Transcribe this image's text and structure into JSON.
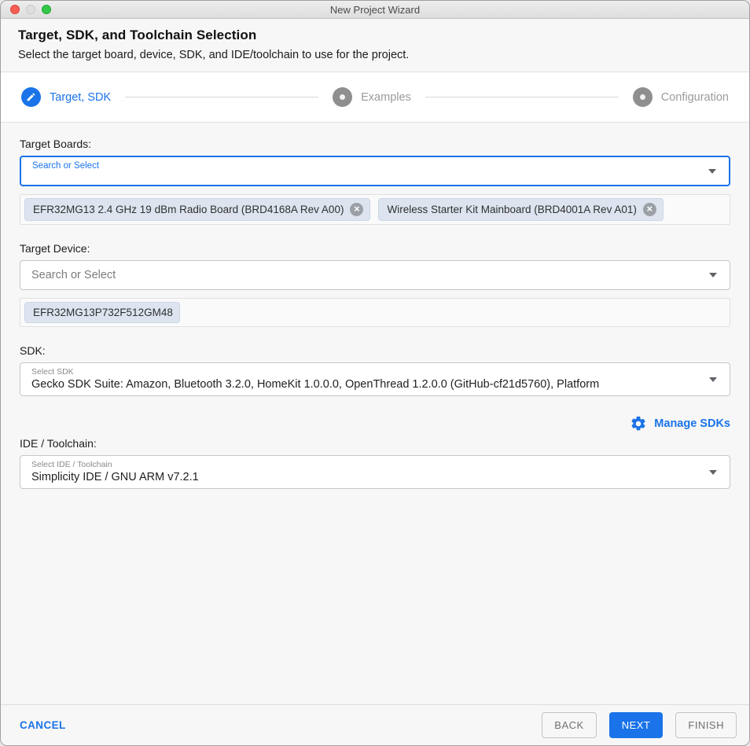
{
  "window": {
    "title": "New Project Wizard"
  },
  "header": {
    "title": "Target, SDK, and Toolchain Selection",
    "subtitle": "Select the target board, device, SDK, and IDE/toolchain to use for the project."
  },
  "stepper": {
    "steps": [
      {
        "label": "Target, SDK",
        "state": "active",
        "icon": "edit-pencil"
      },
      {
        "label": "Examples",
        "state": "inactive",
        "icon": "dot"
      },
      {
        "label": "Configuration",
        "state": "inactive",
        "icon": "dot"
      }
    ]
  },
  "target_boards": {
    "label": "Target Boards:",
    "placeholder": "Search or Select",
    "chips": [
      {
        "label": "EFR32MG13 2.4 GHz 19 dBm Radio Board (BRD4168A Rev A00)",
        "removable": true
      },
      {
        "label": "Wireless Starter Kit Mainboard (BRD4001A Rev A01)",
        "removable": true
      }
    ]
  },
  "target_device": {
    "label": "Target Device:",
    "placeholder": "Search or Select",
    "chips": [
      {
        "label": "EFR32MG13P732F512GM48",
        "removable": false
      }
    ]
  },
  "sdk": {
    "label": "SDK:",
    "field_label": "Select SDK",
    "value": "Gecko SDK Suite: Amazon, Bluetooth 3.2.0, HomeKit 1.0.0.0, OpenThread 1.2.0.0 (GitHub-cf21d5760), Platform",
    "manage_label": "Manage SDKs"
  },
  "ide": {
    "label": "IDE / Toolchain:",
    "field_label": "Select IDE / Toolchain",
    "value": "Simplicity IDE / GNU ARM v7.2.1"
  },
  "footer": {
    "cancel": "CANCEL",
    "back": "BACK",
    "next": "NEXT",
    "finish": "FINISH"
  },
  "colors": {
    "accent": "#1a73e8",
    "inactive_step": "#8f8f8f",
    "chip_bg": "#dde4ef",
    "traffic_red": "#f55e52",
    "traffic_green": "#34c749"
  }
}
